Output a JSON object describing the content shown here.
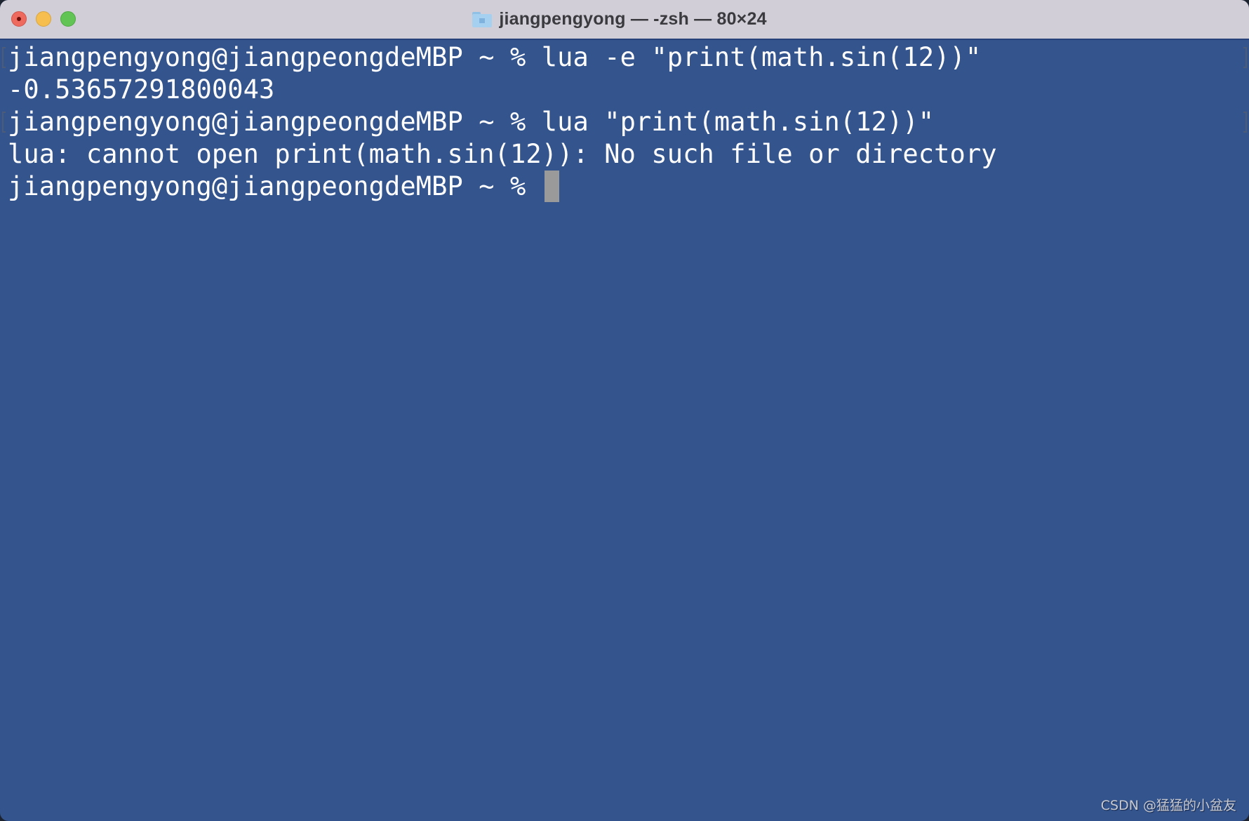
{
  "window": {
    "title": "jiangpengyong — -zsh — 80×24",
    "title_icon": "home-folder-icon",
    "traffic_lights": [
      "close",
      "minimize",
      "zoom"
    ]
  },
  "terminal": {
    "colors": {
      "background": "#34548e",
      "foreground": "#ffffff",
      "cursor": "#9a9a9a"
    },
    "lines": [
      "jiangpengyong@jiangpeongdeMBP ~ % lua -e \"print(math.sin(12))\"",
      "-0.53657291800043",
      "jiangpengyong@jiangpeongdeMBP ~ % lua \"print(math.sin(12))\"",
      "lua: cannot open print(math.sin(12)): No such file or directory",
      "jiangpengyong@jiangpeongdeMBP ~ % "
    ]
  },
  "watermark": "CSDN @猛猛的小盆友"
}
